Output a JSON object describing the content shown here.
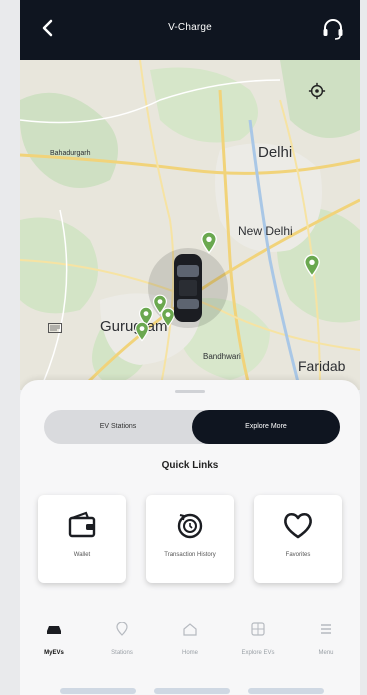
{
  "header": {
    "title": "V-Charge",
    "back_icon": "chevron-left-icon",
    "support_icon": "headset-icon",
    "bg": "#0f1520"
  },
  "map": {
    "labels": {
      "bahadurgarh": "Bahadurgarh",
      "delhi": "Delhi",
      "new_delhi": "New Delhi",
      "gurugram": "Gurugram",
      "faridabad": "Faridab",
      "bandhwari": "Bandhwari"
    },
    "locate_icon": "crosshair-icon",
    "vehicle_icon": "car-topview-icon",
    "station_markers": 6
  },
  "toggle": {
    "left_label": "EV Stations",
    "right_label": "Explore More",
    "selected": "Explore More"
  },
  "quick_links": {
    "title": "Quick Links",
    "items": [
      {
        "label": "Wallet",
        "icon": "wallet-icon"
      },
      {
        "label": "Transaction History",
        "icon": "history-icon"
      },
      {
        "label": "Favorites",
        "icon": "heart-icon"
      }
    ]
  },
  "tabs": [
    {
      "label": "MyEVs",
      "icon": "car-icon",
      "active": true
    },
    {
      "label": "Stations",
      "icon": "pin-icon",
      "active": false
    },
    {
      "label": "Home",
      "icon": "home-icon",
      "active": false
    },
    {
      "label": "Explore EVs",
      "icon": "grid-icon",
      "active": false
    },
    {
      "label": "Menu",
      "icon": "menu-icon",
      "active": false
    }
  ]
}
